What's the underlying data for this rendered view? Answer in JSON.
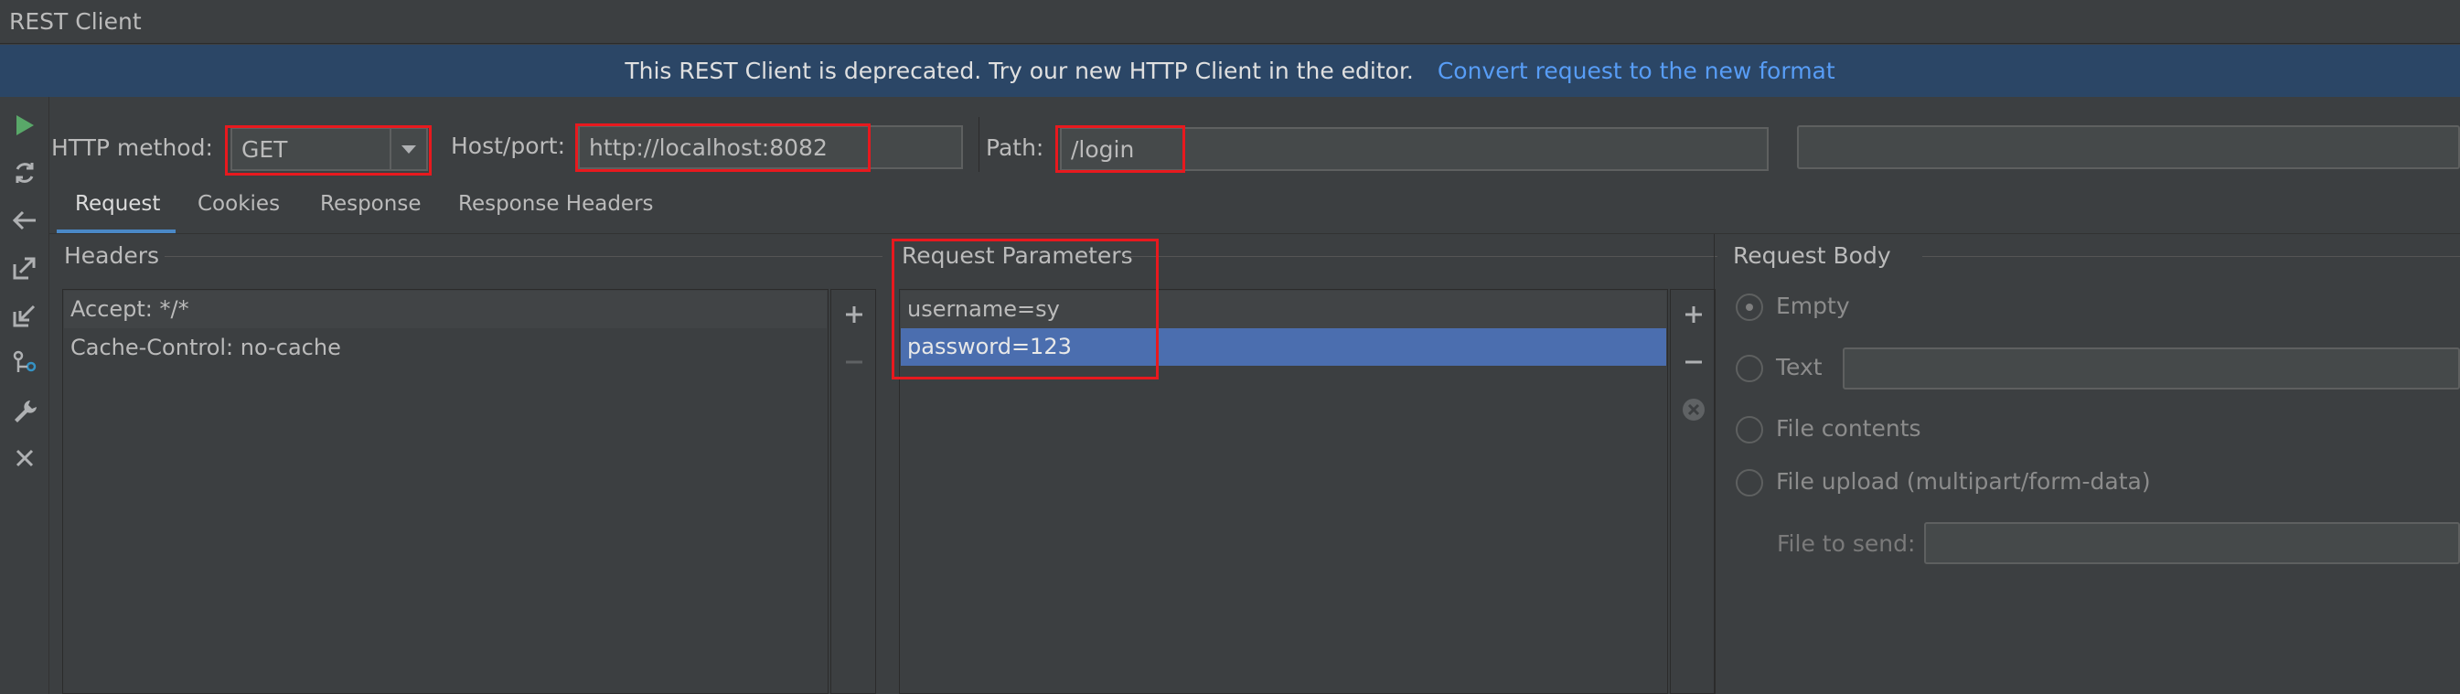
{
  "window": {
    "title": "REST Client"
  },
  "banner": {
    "message": "This REST Client is deprecated. Try our new HTTP Client in the editor.",
    "link": "Convert request to the new format"
  },
  "toolbar_icons": [
    "run-icon",
    "refresh-icon",
    "back-icon",
    "export-icon",
    "import-icon",
    "branch-icon",
    "wrench-icon",
    "close-icon"
  ],
  "request": {
    "method_label": "HTTP method:",
    "method": "GET",
    "host_label": "Host/port:",
    "host": "http://localhost:8082",
    "path_label": "Path:",
    "path": "/login"
  },
  "tabs": [
    "Request",
    "Cookies",
    "Response",
    "Response Headers"
  ],
  "headers": {
    "title": "Headers",
    "items": [
      "Accept: */*",
      "Cache-Control: no-cache"
    ]
  },
  "params": {
    "title": "Request Parameters",
    "items": [
      "username=sy",
      "password=123"
    ],
    "selected_index": 1
  },
  "body": {
    "title": "Request Body",
    "options": [
      "Empty",
      "Text",
      "File contents",
      "File upload (multipart/form-data)"
    ],
    "selected": "Empty",
    "file_label": "File to send:"
  },
  "colors": {
    "accent": "#4a88c7",
    "highlight": "#e8191e",
    "selection": "#4b6eaf",
    "banner": "#2b4666",
    "link": "#589df6"
  }
}
